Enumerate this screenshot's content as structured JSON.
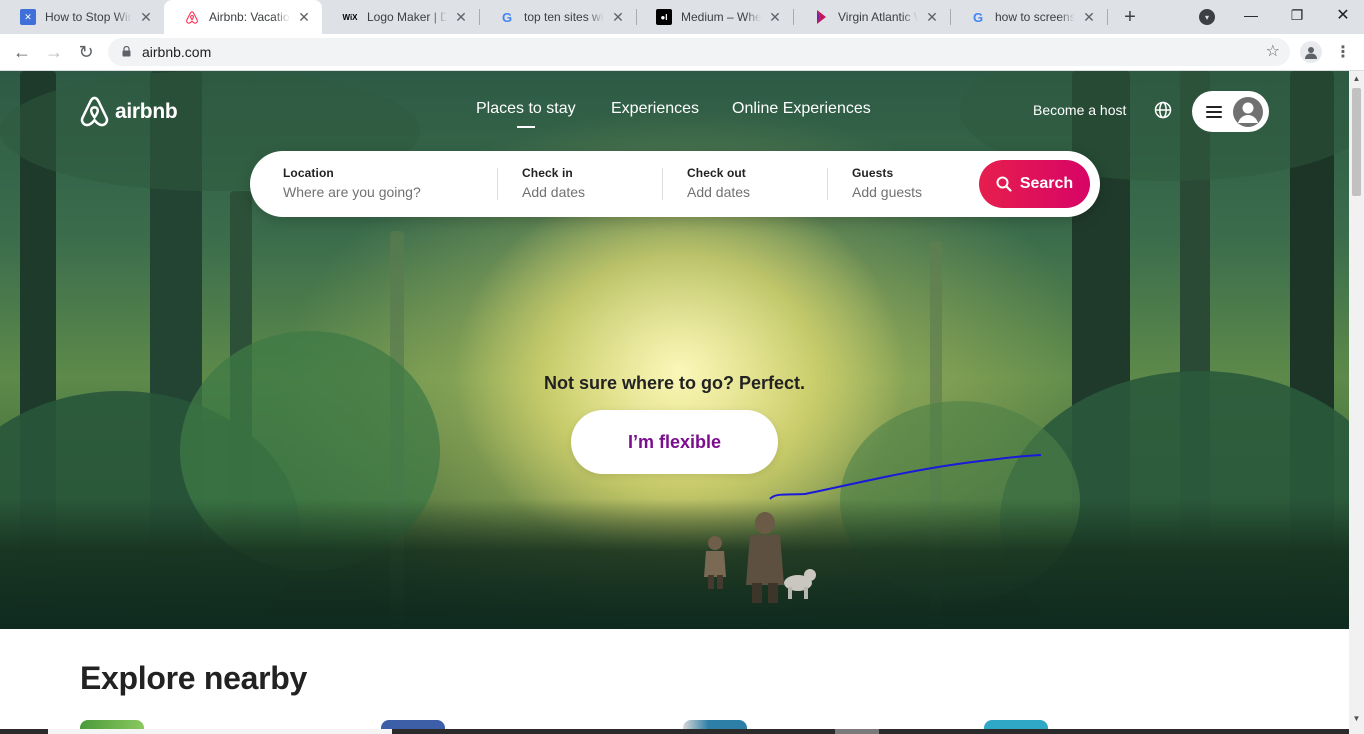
{
  "browser": {
    "tabs": [
      {
        "title": "How to Stop Windows",
        "favicon": "app-favicon",
        "active": false
      },
      {
        "title": "Airbnb: Vacation Rentals",
        "favicon": "airbnb-favicon",
        "active": true
      },
      {
        "title": "Logo Maker | Design",
        "favicon": "wix-favicon",
        "favicon_text": "WiX",
        "active": false
      },
      {
        "title": "top ten sites with",
        "favicon": "google-favicon",
        "favicon_text": "G",
        "active": false
      },
      {
        "title": "Medium – Where good",
        "favicon": "medium-favicon",
        "favicon_text": "●I",
        "active": false
      },
      {
        "title": "Virgin Atlantic Worldwide",
        "favicon": "virgin-favicon",
        "active": false
      },
      {
        "title": "how to screenshot",
        "favicon": "google-favicon",
        "favicon_text": "G",
        "active": false
      }
    ],
    "url": "airbnb.com"
  },
  "header": {
    "logo_text": "airbnb",
    "nav": [
      "Places to stay",
      "Experiences",
      "Online Experiences"
    ],
    "become_host": "Become a host"
  },
  "search": {
    "location_label": "Location",
    "location_placeholder": "Where are you going?",
    "checkin_label": "Check in",
    "checkin_placeholder": "Add dates",
    "checkout_label": "Check out",
    "checkout_placeholder": "Add dates",
    "guests_label": "Guests",
    "guests_placeholder": "Add guests",
    "button_label": "Search"
  },
  "hero": {
    "tagline": "Not sure where to go? Perfect.",
    "flexible_button": "I’m flexible"
  },
  "explore": {
    "heading": "Explore nearby"
  },
  "colors": {
    "brand": "#e61e4d",
    "flexible_text": "#7b0d8e"
  }
}
